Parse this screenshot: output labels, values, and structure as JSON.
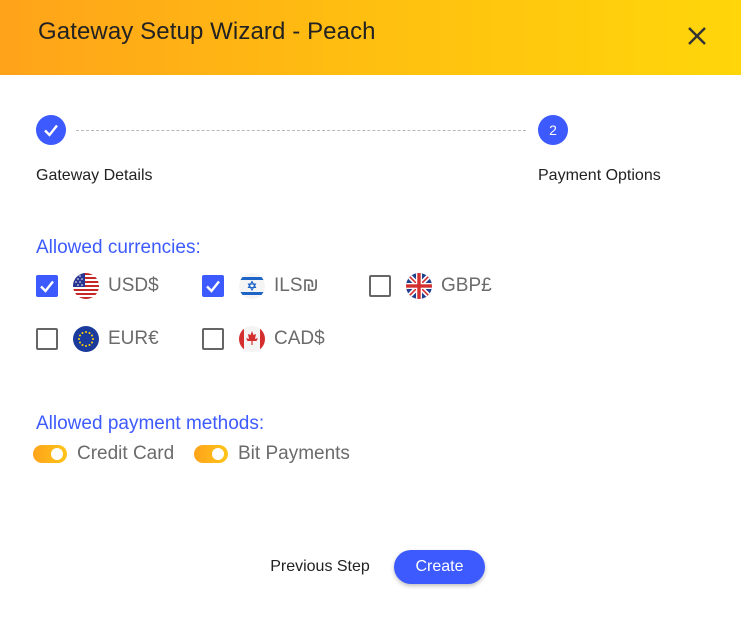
{
  "dialog": {
    "title": "Gateway Setup Wizard - Peach",
    "close_icon": "close-icon"
  },
  "stepper": {
    "steps": [
      {
        "label": "Gateway Details",
        "state": "completed",
        "icon": "check-icon"
      },
      {
        "label": "Payment Options",
        "state": "active",
        "number": "2"
      }
    ]
  },
  "currencies": {
    "label": "Allowed currencies:",
    "items": [
      {
        "code": "USD$",
        "checked": true,
        "flag": "us-flag-icon"
      },
      {
        "code": "ILS₪",
        "checked": true,
        "flag": "israel-flag-icon"
      },
      {
        "code": "GBP£",
        "checked": false,
        "flag": "uk-flag-icon"
      },
      {
        "code": "EUR€",
        "checked": false,
        "flag": "eu-flag-icon"
      },
      {
        "code": "CAD$",
        "checked": false,
        "flag": "canada-flag-icon"
      }
    ]
  },
  "payment_methods": {
    "label": "Allowed payment methods:",
    "items": [
      {
        "label": "Credit Card",
        "enabled": true
      },
      {
        "label": "Bit Payments",
        "enabled": true
      }
    ]
  },
  "footer": {
    "previous_label": "Previous Step",
    "create_label": "Create"
  },
  "colors": {
    "accent": "#3d5afe",
    "header_gradient_start": "#ffa31a",
    "header_gradient_end": "#ffd60a",
    "toggle": "#ffb31a"
  }
}
